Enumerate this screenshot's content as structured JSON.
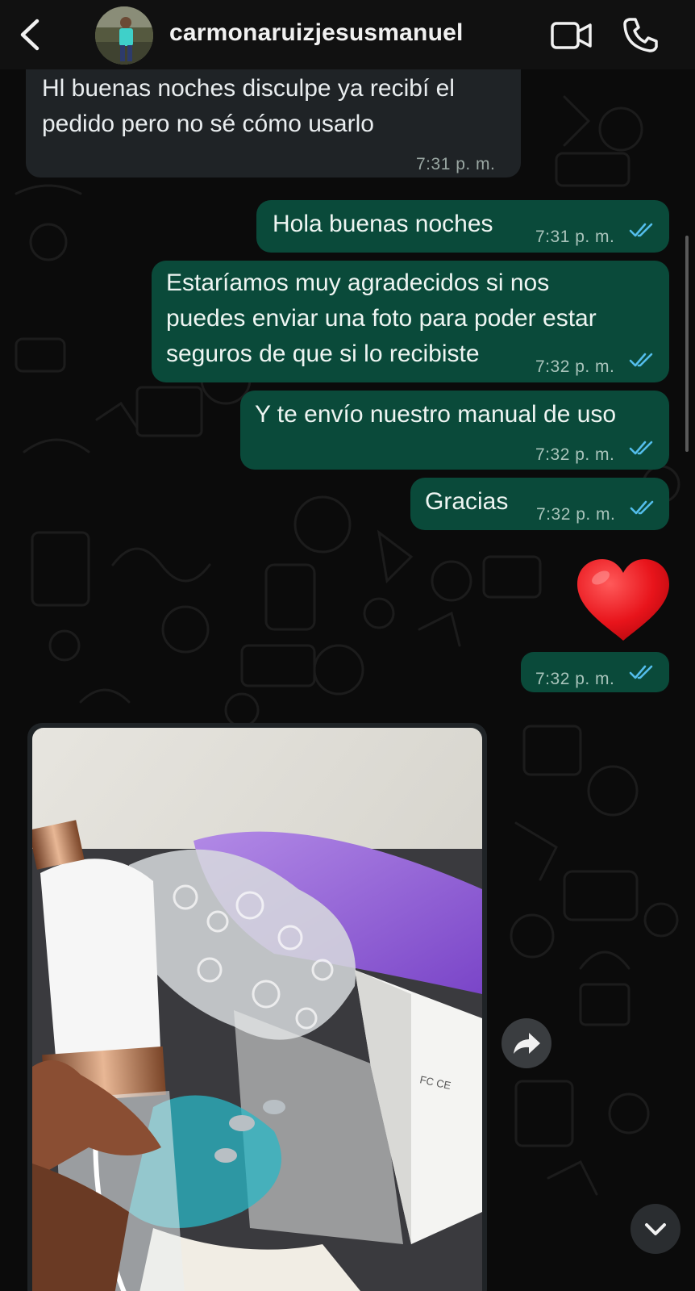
{
  "header": {
    "contact_name": "carmonaruizjesusmanuel",
    "back_icon": "chevron-left-icon",
    "video_icon": "video-camera-icon",
    "call_icon": "phone-icon"
  },
  "messages": [
    {
      "direction": "incoming",
      "lines": [
        "Hl buenas noches disculpe ya recibí el",
        "pedido pero no sé cómo usarlo"
      ],
      "time": "7:31 p. m."
    },
    {
      "direction": "outgoing",
      "lines": [
        "Hola buenas noches"
      ],
      "time": "7:31 p. m.",
      "status": "read"
    },
    {
      "direction": "outgoing",
      "lines": [
        "Estaríamos muy agradecidos si nos",
        "puedes enviar una foto para poder estar",
        "seguros de que si lo recibiste"
      ],
      "time": "7:32 p. m.",
      "status": "read"
    },
    {
      "direction": "outgoing",
      "lines": [
        "Y te envío nuestro manual de uso"
      ],
      "time": "7:32 p. m.",
      "status": "read"
    },
    {
      "direction": "outgoing",
      "lines": [
        "Gracias"
      ],
      "time": "7:32 p. m.",
      "status": "read"
    },
    {
      "direction": "outgoing",
      "emoji": "heart-emoji",
      "time": "7:32 p. m.",
      "status": "read"
    },
    {
      "direction": "incoming",
      "type": "photo",
      "photo": "product-photo"
    }
  ],
  "controls": {
    "forward_icon": "forward-arrow-icon",
    "scroll_icon": "chevron-down-icon"
  },
  "colors": {
    "background": "#0b0b0b",
    "header": "#111111",
    "incoming_bubble": "#1f2326",
    "outgoing_bubble": "#0a4a3a",
    "read_ticks": "#53bdeb"
  }
}
